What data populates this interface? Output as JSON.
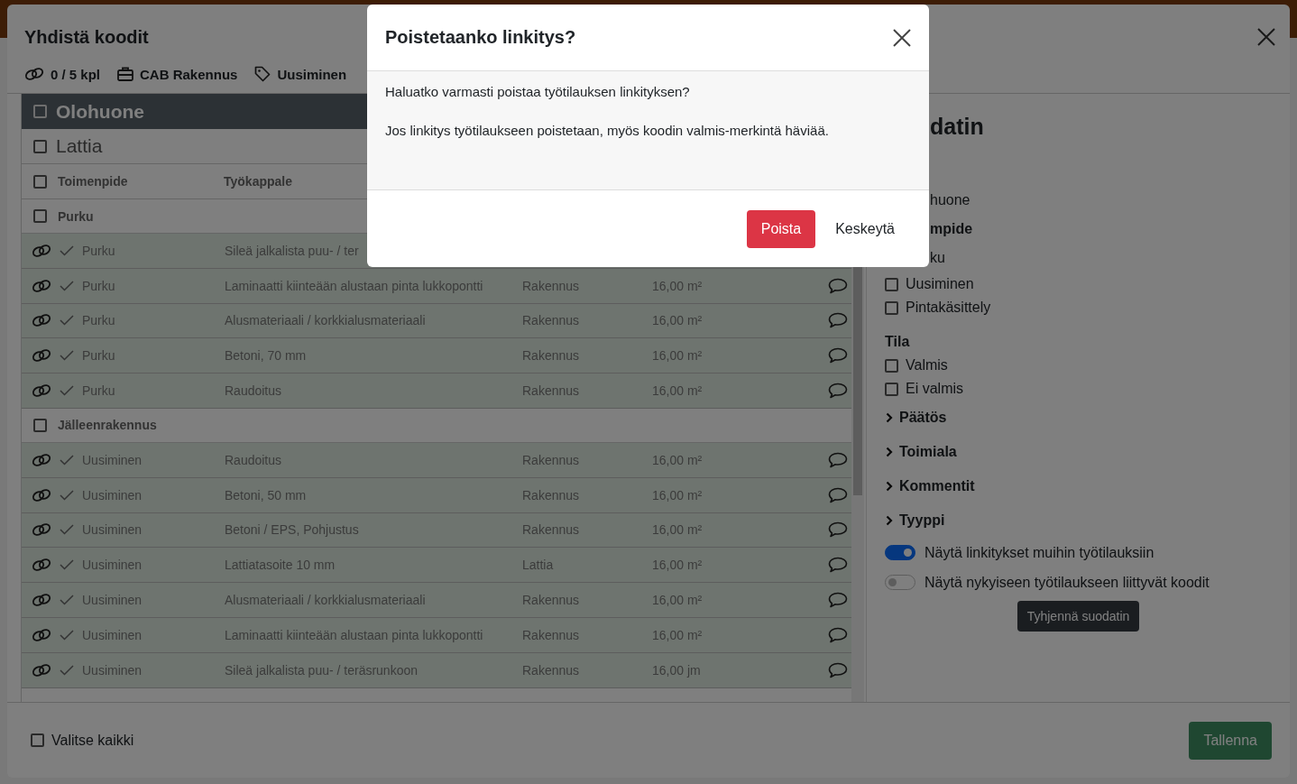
{
  "modal": {
    "title": "Yhdistä koodit",
    "meta": [
      {
        "kind": "link",
        "text": "0 / 5 kpl"
      },
      {
        "kind": "briefcase",
        "text": "CAB Rakennus"
      },
      {
        "kind": "tag",
        "text": "Uusiminen"
      }
    ],
    "table": {
      "room": {
        "label": "Olohuone",
        "checked": false
      },
      "surface": {
        "label": "Lattia",
        "checked": false
      },
      "header": {
        "checked": false,
        "columns": [
          "Toimenpide",
          "Työkappale"
        ]
      },
      "groups": [
        {
          "label": "Purku",
          "checked": false,
          "rows": [
            {
              "linked": true,
              "done": true,
              "action": "Purku",
              "workpiece": "Sileä jalkalista puu- / ter"
            },
            {
              "linked": true,
              "done": true,
              "action": "Purku",
              "workpiece": "Laminaatti kiinteään alustaan pinta lukkopontti",
              "trade": "Rakennus",
              "amount": "16,00 m²",
              "comment": true
            },
            {
              "linked": true,
              "done": true,
              "action": "Purku",
              "workpiece": "Alusmateriaali / korkkialusmateriaali",
              "trade": "Rakennus",
              "amount": "16,00 m²",
              "comment": true
            },
            {
              "linked": true,
              "done": true,
              "action": "Purku",
              "workpiece": "Betoni, 70 mm",
              "trade": "Rakennus",
              "amount": "16,00 m²",
              "comment": true
            },
            {
              "linked": true,
              "done": true,
              "action": "Purku",
              "workpiece": "Raudoitus",
              "trade": "Rakennus",
              "amount": "16,00 m²",
              "comment": true
            }
          ]
        },
        {
          "label": "Jälleenrakennus",
          "checked": false,
          "rows": [
            {
              "linked": true,
              "done": true,
              "action": "Uusiminen",
              "workpiece": "Raudoitus",
              "trade": "Rakennus",
              "amount": "16,00 m²",
              "comment": true
            },
            {
              "linked": true,
              "done": true,
              "action": "Uusiminen",
              "workpiece": "Betoni, 50 mm",
              "trade": "Rakennus",
              "amount": "16,00 m²",
              "comment": true
            },
            {
              "linked": true,
              "done": true,
              "action": "Uusiminen",
              "workpiece": "Betoni / EPS, Pohjustus",
              "trade": "Rakennus",
              "amount": "16,00 m²",
              "comment": true
            },
            {
              "linked": true,
              "done": true,
              "action": "Uusiminen",
              "workpiece": "Lattiatasoite 10 mm",
              "trade": "Lattia",
              "amount": "16,00 m²",
              "comment": true
            },
            {
              "linked": true,
              "done": true,
              "action": "Uusiminen",
              "workpiece": "Alusmateriaali / korkkialusmateriaali",
              "trade": "Rakennus",
              "amount": "16,00 m²",
              "comment": true
            },
            {
              "linked": true,
              "done": true,
              "action": "Uusiminen",
              "workpiece": "Laminaatti kiinteään alustaan pinta lukkopontti",
              "trade": "Rakennus",
              "amount": "16,00 m²",
              "comment": true
            },
            {
              "linked": true,
              "done": true,
              "action": "Uusiminen",
              "workpiece": "Sileä jalkalista puu- / teräsrunkoon",
              "trade": "Rakennus",
              "amount": "16,00 jm",
              "comment": true
            }
          ]
        }
      ]
    },
    "filters": {
      "title": "datin",
      "items": [
        {
          "kind": "text",
          "label": "huone"
        },
        {
          "kind": "heading",
          "label": "mpide"
        },
        {
          "kind": "text",
          "label": "ku"
        },
        {
          "kind": "checkbox",
          "label": "Uusiminen",
          "checked": false
        },
        {
          "kind": "checkbox",
          "label": "Pintakäsittely",
          "checked": false
        },
        {
          "kind": "heading",
          "label": "Tila"
        },
        {
          "kind": "checkbox",
          "label": "Valmis",
          "checked": false
        },
        {
          "kind": "checkbox",
          "label": "Ei valmis",
          "checked": false
        },
        {
          "kind": "section",
          "label": "Päätös",
          "expanded": false
        },
        {
          "kind": "section",
          "label": "Toimiala",
          "expanded": false
        },
        {
          "kind": "section",
          "label": "Kommentit",
          "expanded": false
        },
        {
          "kind": "section",
          "label": "Tyyppi",
          "expanded": false
        },
        {
          "kind": "toggle",
          "label": "Näytä linkitykset muihin työtilauksiin",
          "on": true
        },
        {
          "kind": "toggle",
          "label": "Näytä nykyiseen työtilaukseen liittyvät koodit",
          "on": false
        }
      ],
      "clear_button": "Tyhjennä suodatin"
    },
    "footer": {
      "select_all": {
        "label": "Valitse kaikki",
        "checked": false
      },
      "save": {
        "label": "Tallenna",
        "disabled": true
      }
    }
  },
  "dialog": {
    "title": "Poistetaanko linkitys?",
    "paragraphs": [
      "Haluatko varmasti poistaa työtilauksen linkityksen?",
      "Jos linkitys työtilaukseen poistetaan, myös koodin valmis-merkintä häviää."
    ],
    "buttons": [
      {
        "kind": "danger",
        "label": "Poista"
      },
      {
        "kind": "plain",
        "label": "Keskeytä"
      }
    ]
  }
}
